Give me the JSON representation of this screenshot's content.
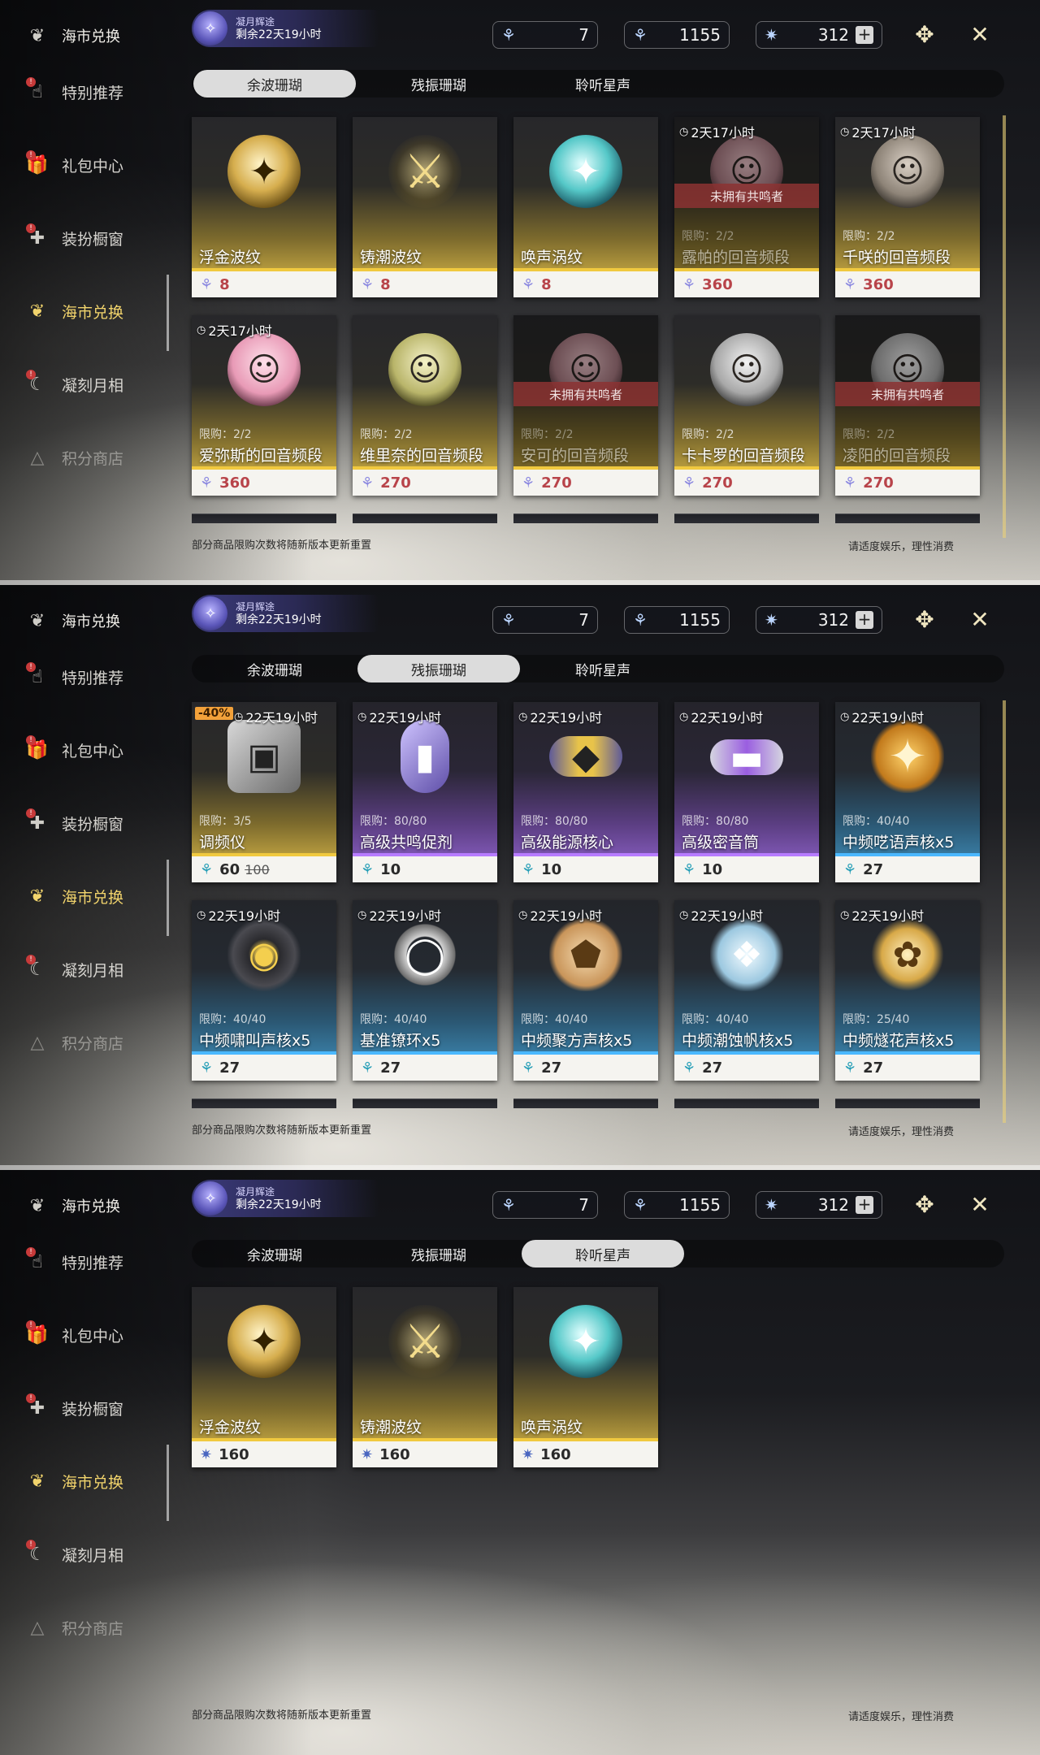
{
  "sidebar_header": "海市兑换",
  "sidebar": [
    {
      "label": "特别推荐",
      "badge": "!",
      "icon": "hand-card-icon",
      "state": "normal"
    },
    {
      "label": "礼包中心",
      "badge": "!",
      "icon": "gift-icon",
      "state": "normal"
    },
    {
      "label": "装扮橱窗",
      "badge": "!",
      "icon": "wardrobe-icon",
      "state": "normal"
    },
    {
      "label": "海市兑换",
      "badge": "",
      "icon": "coral-icon",
      "state": "active"
    },
    {
      "label": "凝刻月相",
      "badge": "!",
      "icon": "moon-icon",
      "state": "normal"
    },
    {
      "label": "积分商店",
      "badge": "",
      "icon": "triangle-icon",
      "state": "dim"
    }
  ],
  "event": {
    "title": "凝月辉途",
    "remaining": "剩余22天19小时"
  },
  "currencies": [
    {
      "icon": "coral-blue-icon",
      "value": "7"
    },
    {
      "icon": "coral-teal-icon",
      "value": "1155"
    },
    {
      "icon": "star-shard-icon",
      "value": "312",
      "plus": "+"
    }
  ],
  "tabs": [
    "余波珊瑚",
    "残振珊瑚",
    "聆听星声"
  ],
  "footer": {
    "note": "部分商品限购次数将随新版本更新重置",
    "advice": "请适度娱乐，理性消费"
  },
  "panels": [
    {
      "selected_tab": 0,
      "cards": [
        {
          "name": "浮金波纹",
          "price": "8",
          "price_style": "red",
          "price_icon": "purple",
          "quality": "gold",
          "art": "gold-orb",
          "glyph": "✦"
        },
        {
          "name": "铸潮波纹",
          "price": "8",
          "price_style": "red",
          "price_icon": "purple",
          "quality": "gold",
          "art": "sword",
          "glyph": "⚔"
        },
        {
          "name": "唤声涡纹",
          "price": "8",
          "price_style": "red",
          "price_icon": "purple",
          "quality": "gold",
          "art": "teal-orb",
          "glyph": "✦"
        },
        {
          "name": "露帕的回音频段",
          "price": "360",
          "price_style": "red",
          "price_icon": "purple",
          "quality": "gold",
          "art": "portrait-rose",
          "glyph": "☺",
          "timer": "2天17小时",
          "limit": "限购：2/2",
          "not_owned": "未拥有共鸣者"
        },
        {
          "name": "千咲的回音频段",
          "price": "360",
          "price_style": "red",
          "price_icon": "purple",
          "quality": "gold",
          "art": "portrait",
          "glyph": "☺",
          "timer": "2天17小时",
          "limit": "限购：2/2"
        },
        {
          "name": "爱弥斯的回音频段",
          "price": "360",
          "price_style": "red",
          "price_icon": "purple",
          "quality": "gold",
          "art": "portrait-pink",
          "glyph": "☺",
          "timer": "2天17小时",
          "limit": "限购：2/2"
        },
        {
          "name": "维里奈的回音频段",
          "price": "270",
          "price_style": "red",
          "price_icon": "purple",
          "quality": "gold",
          "art": "portrait-green",
          "glyph": "☺",
          "limit": "限购：2/2"
        },
        {
          "name": "安可的回音频段",
          "price": "270",
          "price_style": "red",
          "price_icon": "purple",
          "quality": "gold",
          "art": "portrait-rose",
          "glyph": "☺",
          "limit": "限购：2/2",
          "not_owned": "未拥有共鸣者"
        },
        {
          "name": "卡卡罗的回音频段",
          "price": "270",
          "price_style": "red",
          "price_icon": "purple",
          "quality": "gold",
          "art": "portrait-grey",
          "glyph": "☺",
          "limit": "限购：2/2"
        },
        {
          "name": "凌阳的回音频段",
          "price": "270",
          "price_style": "red",
          "price_icon": "purple",
          "quality": "gold",
          "art": "portrait-grey",
          "glyph": "☺",
          "limit": "限购：2/2",
          "not_owned": "未拥有共鸣者"
        }
      ]
    },
    {
      "selected_tab": 1,
      "cards": [
        {
          "name": "调频仪",
          "price": "60",
          "old_price": "100",
          "discount": "-40%",
          "price_style": "dark",
          "price_icon": "teal",
          "quality": "gold",
          "art": "device",
          "glyph": "▣",
          "timer": "22天19小时",
          "limit": "限购：3/5"
        },
        {
          "name": "高级共鸣促剂",
          "price": "10",
          "price_style": "dark",
          "price_icon": "teal",
          "quality": "purple",
          "art": "vial",
          "glyph": "▮",
          "timer": "22天19小时",
          "limit": "限购：80/80"
        },
        {
          "name": "高级能源核心",
          "price": "10",
          "price_style": "dark",
          "price_icon": "teal",
          "quality": "purple",
          "art": "core",
          "glyph": "◆",
          "timer": "22天19小时",
          "limit": "限购：80/80"
        },
        {
          "name": "高级密音筒",
          "price": "10",
          "price_style": "dark",
          "price_icon": "teal",
          "quality": "purple",
          "art": "tube",
          "glyph": "▬",
          "timer": "22天19小时",
          "limit": "限购：80/80"
        },
        {
          "name": "中频呓语声核x5",
          "price": "27",
          "price_style": "dark",
          "price_icon": "teal",
          "quality": "blue",
          "art": "star",
          "glyph": "✦",
          "timer": "22天19小时",
          "limit": "限购：40/40"
        },
        {
          "name": "中频啸叫声核x5",
          "price": "27",
          "price_style": "dark",
          "price_icon": "teal",
          "quality": "blue",
          "art": "dark",
          "glyph": "◉",
          "timer": "22天19小时",
          "limit": "限购：40/40"
        },
        {
          "name": "基准镣环x5",
          "price": "27",
          "price_style": "dark",
          "price_icon": "teal",
          "quality": "blue",
          "art": "ring",
          "glyph": "◯",
          "timer": "22天19小时",
          "limit": "限购：40/40"
        },
        {
          "name": "中频聚方声核x5",
          "price": "27",
          "price_style": "dark",
          "price_icon": "teal",
          "quality": "blue",
          "art": "pent",
          "glyph": "⬟",
          "timer": "22天19小时",
          "limit": "限购：40/40"
        },
        {
          "name": "中频潮蚀帆核x5",
          "price": "27",
          "price_style": "dark",
          "price_icon": "teal",
          "quality": "blue",
          "art": "shell",
          "glyph": "❖",
          "timer": "22天19小时",
          "limit": "限购：40/40"
        },
        {
          "name": "中频燧花声核x5",
          "price": "27",
          "price_style": "dark",
          "price_icon": "teal",
          "quality": "blue",
          "art": "petal",
          "glyph": "✿",
          "timer": "22天19小时",
          "limit": "限购：25/40"
        }
      ]
    },
    {
      "selected_tab": 2,
      "cards": [
        {
          "name": "浮金波纹",
          "price": "160",
          "price_style": "dark",
          "price_icon": "blue",
          "quality": "gold",
          "art": "gold-orb",
          "glyph": "✦"
        },
        {
          "name": "铸潮波纹",
          "price": "160",
          "price_style": "dark",
          "price_icon": "blue",
          "quality": "gold",
          "art": "sword",
          "glyph": "⚔"
        },
        {
          "name": "唤声涡纹",
          "price": "160",
          "price_style": "dark",
          "price_icon": "blue",
          "quality": "gold",
          "art": "teal-orb",
          "glyph": "✦"
        }
      ]
    }
  ]
}
